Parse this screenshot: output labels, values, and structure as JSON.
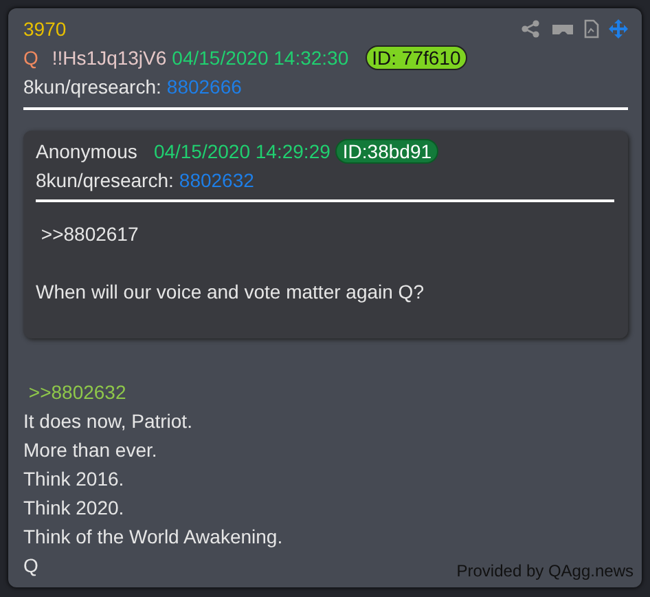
{
  "post": {
    "number": "3970",
    "author": "Q",
    "tripcode": "!!Hs1Jq13jV6",
    "timestamp": "04/15/2020 14:32:30",
    "id": "ID: 77f610",
    "board": "8kun/qresearch:",
    "post_link": "8802666"
  },
  "quoted_post": {
    "author": "Anonymous",
    "timestamp": "04/15/2020 14:29:29",
    "id": "ID:38bd91",
    "board": "8kun/qresearch:",
    "post_link": "8802632",
    "body": [
      {
        "kind": "quote",
        "text": " >>8802617"
      },
      {
        "kind": "text",
        "text": "When will our voice and vote matter again Q?"
      }
    ]
  },
  "body": [
    {
      "kind": "reply_link",
      "text": " >>8802632"
    },
    {
      "kind": "text",
      "text": "It does now, Patriot."
    },
    {
      "kind": "text",
      "text": "More than ever."
    },
    {
      "kind": "text",
      "text": "Think 2016."
    },
    {
      "kind": "text",
      "text": "Think 2020."
    },
    {
      "kind": "text",
      "text": "Think of the World Awakening."
    },
    {
      "kind": "text",
      "text": "Q"
    }
  ],
  "footer": "Provided by QAgg.news"
}
